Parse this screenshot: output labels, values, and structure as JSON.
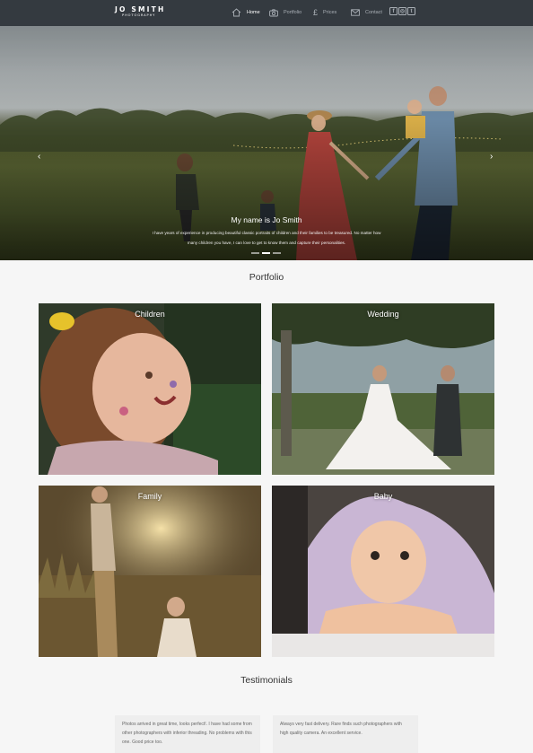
{
  "brand": {
    "line1": "JO SMITH",
    "line2": "PHOTOGRAPHY"
  },
  "nav": {
    "items": [
      {
        "label": "Home",
        "icon": "home-icon"
      },
      {
        "label": "Portfolio",
        "icon": "camera-icon"
      },
      {
        "label": "Prices",
        "icon": "pound-icon"
      },
      {
        "label": "Contact",
        "icon": "envelope-icon"
      }
    ],
    "social": [
      {
        "icon": "facebook-icon",
        "glyph": "f"
      },
      {
        "icon": "instagram-icon",
        "glyph": "◎"
      },
      {
        "icon": "twitter-icon",
        "glyph": "t"
      }
    ]
  },
  "hero": {
    "title": "My name is Jo Smith",
    "text": "I have years of experience in producing beautiful classic portraits of children and their families to be treasured. No matter how many children you have, I can love to get to know them and capture their personalities.",
    "prev": "‹",
    "next": "›"
  },
  "portfolio": {
    "title": "Portfolio",
    "cards": [
      "Children",
      "Wedding",
      "Family",
      "Baby"
    ]
  },
  "testimonials": {
    "title": "Testimonials",
    "items": [
      "Photos arrived in great time, looks perfect!. I have had some from other photographers with inferior threading. No problems with this one. Good price too.",
      "Always very fast delivery. Rare finds such photographers with high quality camera. An excellent service."
    ]
  },
  "colors": {
    "navbar": "#343a40",
    "page": "#f6f6f6",
    "nav_active": "#ffffff",
    "nav_inactive": "#aab0b6"
  }
}
